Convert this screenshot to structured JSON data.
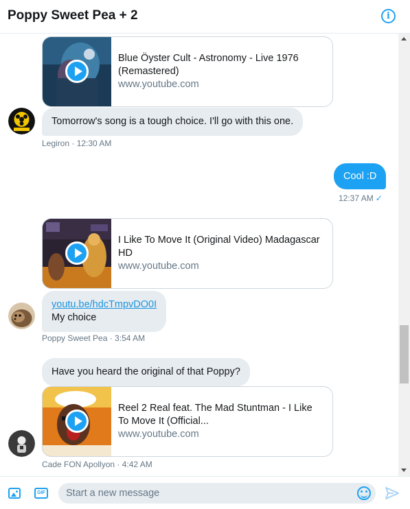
{
  "header": {
    "title": "Poppy Sweet Pea + 2",
    "info_icon": "info-icon",
    "info_glyph": "i"
  },
  "messages": {
    "card1": {
      "title": "Blue Öyster Cult - Astronomy - Live 1976 (Remastered)",
      "domain": "www.youtube.com"
    },
    "msg1": {
      "text": "Tomorrow's song is a tough choice. I'll go with this one.",
      "meta": "Legiron · 12:30 AM"
    },
    "msg2": {
      "text": "Cool :D",
      "meta": "12:37 AM",
      "status_icon": "checkmark-icon",
      "status_glyph": "✓"
    },
    "card2": {
      "title": "I Like To Move It (Original Video) Madagascar HD",
      "domain": "www.youtube.com"
    },
    "msg3": {
      "link": "youtu.be/hdcTmpvDO0I",
      "text": "My choice",
      "meta": "Poppy Sweet Pea · 3:54 AM"
    },
    "msg4": {
      "text": "Have you heard the original of that Poppy?"
    },
    "card3": {
      "title": "Reel 2 Real feat. The Mad Stuntman - I Like To Move It (Official...",
      "domain": "www.youtube.com"
    },
    "msg4_meta": "Cade FON Apollyon · 4:42 AM"
  },
  "composer": {
    "placeholder": "Start a new message",
    "gif_label": "GIF",
    "media_icon": "image-icon",
    "emoji_icon": "emoji-icon",
    "send_icon": "send-icon"
  },
  "colors": {
    "accent": "#1da1f2",
    "bubble_in": "#e6ecf0",
    "meta_text": "#657786"
  }
}
